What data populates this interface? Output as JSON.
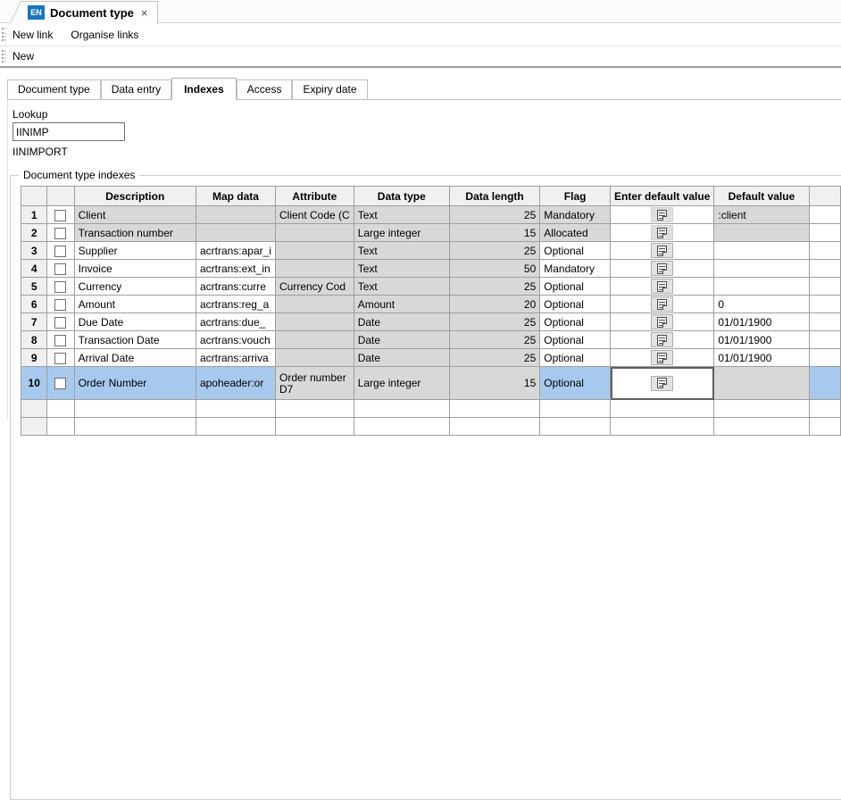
{
  "doc_tab": {
    "badge": "EN",
    "title": "Document type",
    "close_label": "×"
  },
  "toolbar_links": {
    "items": [
      {
        "label": "New link"
      },
      {
        "label": "Organise links"
      }
    ]
  },
  "toolbar_new": {
    "items": [
      {
        "label": "New"
      }
    ]
  },
  "page_tabs": {
    "items": [
      {
        "label": "Document type",
        "active": false
      },
      {
        "label": "Data entry",
        "active": false
      },
      {
        "label": "Indexes",
        "active": true
      },
      {
        "label": "Access",
        "active": false
      },
      {
        "label": "Expiry date",
        "active": false
      }
    ]
  },
  "lookup": {
    "label": "Lookup",
    "value": "IINIMP",
    "description": "IINIMPORT"
  },
  "group": {
    "title": "Document type indexes"
  },
  "table": {
    "headers": {
      "description": "Description",
      "map_data": "Map data",
      "attribute": "Attribute",
      "data_type": "Data type",
      "data_length": "Data length",
      "flag": "Flag",
      "enter_default": "Enter default value",
      "default_value": "Default value"
    },
    "rows": [
      {
        "num": "1",
        "description": "Client",
        "map_data": "",
        "attribute": "Client Code (C",
        "data_type": "Text",
        "data_length": "25",
        "flag": "Mandatory",
        "default_value": ":client"
      },
      {
        "num": "2",
        "description": "Transaction number",
        "map_data": "",
        "attribute": "",
        "data_type": "Large integer",
        "data_length": "15",
        "flag": "Allocated",
        "default_value": ""
      },
      {
        "num": "3",
        "description": "Supplier",
        "map_data": "acrtrans:apar_i",
        "attribute": "",
        "data_type": "Text",
        "data_length": "25",
        "flag": "Optional",
        "default_value": ""
      },
      {
        "num": "4",
        "description": "Invoice",
        "map_data": "acrtrans:ext_in",
        "attribute": "",
        "data_type": "Text",
        "data_length": "50",
        "flag": "Mandatory",
        "default_value": ""
      },
      {
        "num": "5",
        "description": "Currency",
        "map_data": "acrtrans:curre",
        "attribute": "Currency Cod",
        "data_type": "Text",
        "data_length": "25",
        "flag": "Optional",
        "default_value": ""
      },
      {
        "num": "6",
        "description": "Amount",
        "map_data": "acrtrans:reg_a",
        "attribute": "",
        "data_type": "Amount",
        "data_length": "20",
        "flag": "Optional",
        "default_value": "0"
      },
      {
        "num": "7",
        "description": "Due Date",
        "map_data": "acrtrans:due_",
        "attribute": "",
        "data_type": "Date",
        "data_length": "25",
        "flag": "Optional",
        "default_value": "01/01/1900"
      },
      {
        "num": "8",
        "description": "Transaction Date",
        "map_data": "acrtrans:vouch",
        "attribute": "",
        "data_type": "Date",
        "data_length": "25",
        "flag": "Optional",
        "default_value": "01/01/1900"
      },
      {
        "num": "9",
        "description": "Arrival Date",
        "map_data": "acrtrans:arriva",
        "attribute": "",
        "data_type": "Date",
        "data_length": "25",
        "flag": "Optional",
        "default_value": "01/01/1900"
      },
      {
        "num": "10",
        "description": "Order Number",
        "map_data": "apoheader:or",
        "attribute": "Order number D7",
        "data_type": "Large integer",
        "data_length": "15",
        "flag": "Optional",
        "default_value": ""
      }
    ],
    "selected_row_num": "10"
  },
  "icons": {
    "enter_default_button": "note-edit-icon"
  },
  "colors": {
    "badge_blue": "#1b75bb",
    "selected_row_blue": "#a8c9ee",
    "readonly_cell_gray": "#d8d8d8",
    "header_gray": "#f0f0f0",
    "grid_line_gray": "#9e9e9e"
  }
}
